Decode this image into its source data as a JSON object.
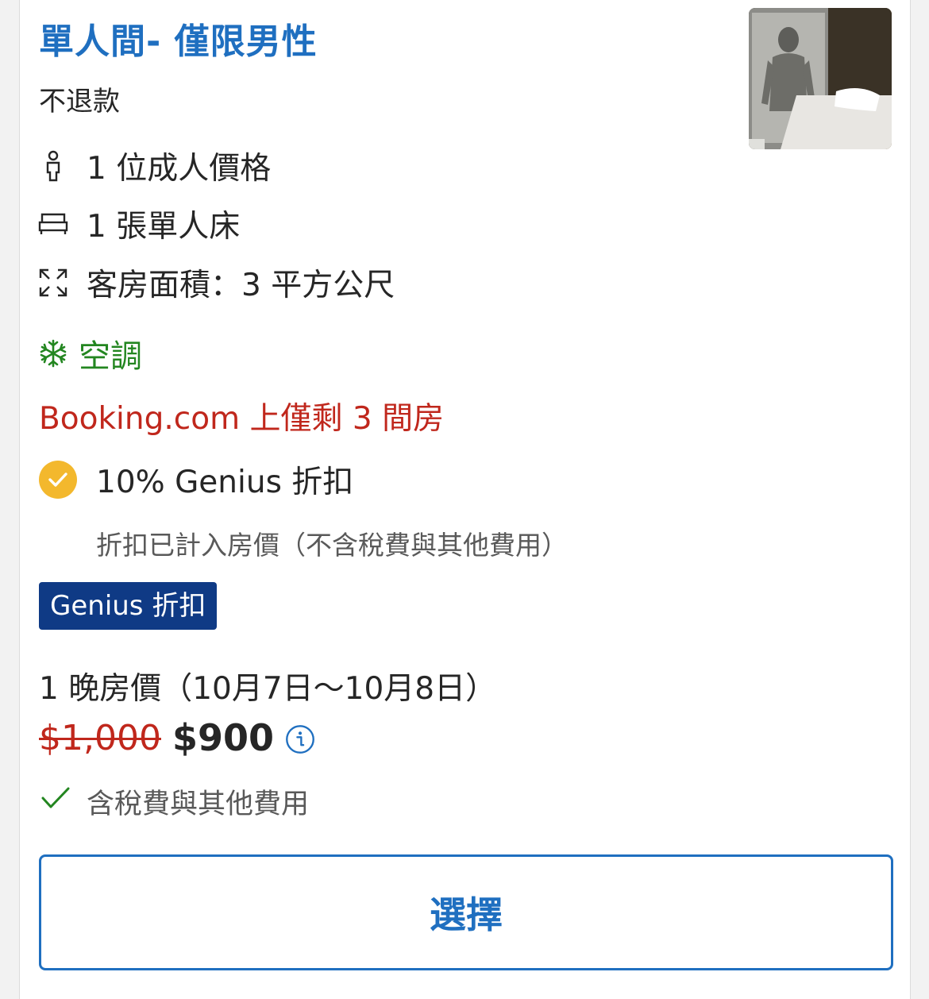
{
  "room": {
    "title": "單人間- 僅限男性",
    "refund_policy": "不退款"
  },
  "features": {
    "occupancy": "1 位成人價格",
    "bed": "1 張單人床",
    "size": "客房面積：3 平方公尺",
    "amenity": "空調"
  },
  "icons": {
    "occupancy": "person-icon",
    "bed": "bed-icon",
    "size": "expand-arrows-icon",
    "amenity": "snowflake-icon",
    "genius": "check-circle-icon",
    "price_info": "info-icon",
    "tax": "checkmark-icon"
  },
  "availability": {
    "scarcity": "Booking.com 上僅剩 3 間房"
  },
  "genius": {
    "discount_label": "10% Genius 折扣",
    "note": "折扣已計入房價（不含稅費與其他費用）",
    "badge": "Genius 折扣"
  },
  "pricing": {
    "nights_label": "1 晚房價（10月7日～10月8日）",
    "original_price": "$1,000",
    "price": "$900",
    "tax_note": "含稅費與其他費用"
  },
  "actions": {
    "select_label": "選擇"
  },
  "colors": {
    "title_blue": "#1f6fc0",
    "amenity_green": "#238620",
    "scarcity_red": "#c0271c",
    "genius_yellow": "#f3b82d",
    "genius_badge_navy": "#0f3a85"
  }
}
